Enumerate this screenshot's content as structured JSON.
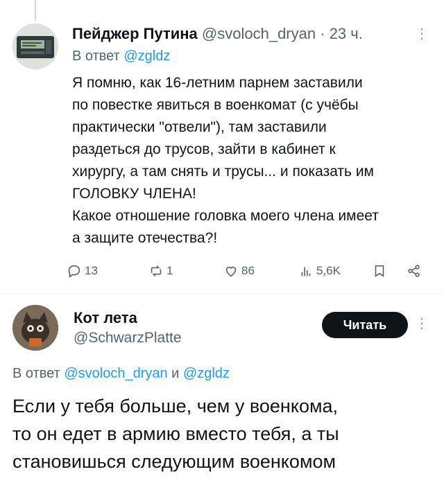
{
  "tweet1": {
    "author_name": "Пейджер Путина",
    "author_handle": "@svoloch_dryan",
    "separator": "·",
    "time": "23 ч.",
    "reply_prefix": "В ответ",
    "reply_mention": "@zgldz",
    "body_lines": [
      "Я помню, как 16-летним парнем заставили",
      "по повестке явиться в военкомат (с учёбы",
      "практически \"отвели\"), там заставили",
      "раздеться до трусов, зайти в кабинет к",
      "хирургу, а там снять и трусы... и показать им",
      "ГОЛОВКУ ЧЛЕНА!",
      "Какое отношение головка моего члена имеет",
      "а защите отечества?!"
    ],
    "stats": {
      "replies": "13",
      "reposts": "1",
      "likes": "86",
      "views": "5,6K"
    }
  },
  "tweet2": {
    "author_name": "Кот лета",
    "author_handle": "@SchwarzPlatte",
    "follow_label": "Читать",
    "reply_prefix": "В ответ",
    "reply_mention_1": "@svoloch_dryan",
    "reply_conj": "и",
    "reply_mention_2": "@zgldz",
    "body_lines": [
      "Если у тебя больше, чем у военкома,",
      "то он едет в армию вместо тебя, а ты",
      "становишься следующим военкомом"
    ]
  },
  "icons": {
    "reply": "reply-icon",
    "repost": "repost-icon",
    "like": "heart-icon",
    "views": "views-icon",
    "bookmark": "bookmark-icon",
    "share": "share-icon",
    "more": "more-icon"
  },
  "colors": {
    "link": "#1d9bf0",
    "muted": "#536471",
    "text": "#0f1419",
    "button": "#0f1419"
  }
}
